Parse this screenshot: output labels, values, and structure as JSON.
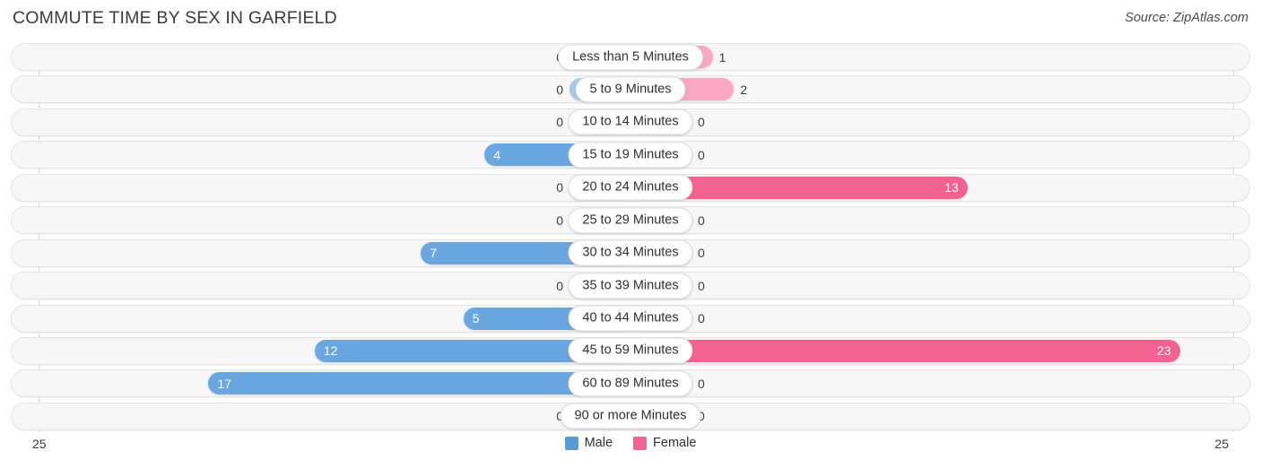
{
  "header": {
    "title": "COMMUTE TIME BY SEX IN GARFIELD",
    "source": "Source: ZipAtlas.com"
  },
  "axis": {
    "left_label": "25",
    "right_label": "25"
  },
  "legend": {
    "items": [
      {
        "label": "Male",
        "color": "#5b9bd5"
      },
      {
        "label": "Female",
        "color": "#f2628f"
      }
    ]
  },
  "colors": {
    "male_light": "#a7c9ea",
    "male_dark": "#6aa6e0",
    "female_light": "#f9a7c3",
    "female_dark": "#f2628f",
    "track": "#f7f7f7",
    "gridline": "#d8d8d8"
  },
  "chart_data": {
    "type": "bar",
    "title": "COMMUTE TIME BY SEX IN GARFIELD",
    "subtitle": "Source: ZipAtlas.com",
    "orientation": "horizontal-diverging",
    "xlabel": "",
    "ylabel": "",
    "xlim": [
      25,
      25
    ],
    "grid": true,
    "legend_position": "bottom-center",
    "categories": [
      "Less than 5 Minutes",
      "5 to 9 Minutes",
      "10 to 14 Minutes",
      "15 to 19 Minutes",
      "20 to 24 Minutes",
      "25 to 29 Minutes",
      "30 to 34 Minutes",
      "35 to 39 Minutes",
      "40 to 44 Minutes",
      "45 to 59 Minutes",
      "60 to 89 Minutes",
      "90 or more Minutes"
    ],
    "series": [
      {
        "name": "Male",
        "values": [
          0,
          0,
          0,
          4,
          0,
          0,
          7,
          0,
          5,
          12,
          17,
          0
        ]
      },
      {
        "name": "Female",
        "values": [
          1,
          2,
          0,
          0,
          13,
          0,
          0,
          0,
          0,
          23,
          0,
          0
        ]
      }
    ]
  },
  "rows": [
    {
      "label": "Less than 5 Minutes",
      "male": "0",
      "female": "1"
    },
    {
      "label": "5 to 9 Minutes",
      "male": "0",
      "female": "2"
    },
    {
      "label": "10 to 14 Minutes",
      "male": "0",
      "female": "0"
    },
    {
      "label": "15 to 19 Minutes",
      "male": "4",
      "female": "0"
    },
    {
      "label": "20 to 24 Minutes",
      "male": "0",
      "female": "13"
    },
    {
      "label": "25 to 29 Minutes",
      "male": "0",
      "female": "0"
    },
    {
      "label": "30 to 34 Minutes",
      "male": "7",
      "female": "0"
    },
    {
      "label": "35 to 39 Minutes",
      "male": "0",
      "female": "0"
    },
    {
      "label": "40 to 44 Minutes",
      "male": "5",
      "female": "0"
    },
    {
      "label": "45 to 59 Minutes",
      "male": "12",
      "female": "23"
    },
    {
      "label": "60 to 89 Minutes",
      "male": "17",
      "female": "0"
    },
    {
      "label": "90 or more Minutes",
      "male": "0",
      "female": "0"
    }
  ]
}
